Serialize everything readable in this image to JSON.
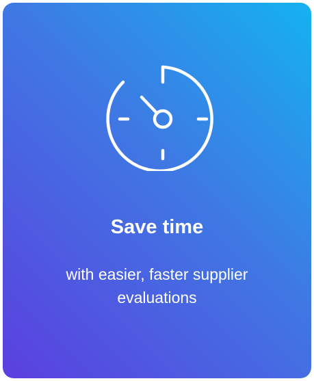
{
  "card": {
    "icon": "stopwatch-timer-icon",
    "title": "Save time",
    "subtitle": "with easier, faster supplier evaluations",
    "gradient_colors": [
      "#14b2f0",
      "#3f78e3",
      "#5b3fdf"
    ],
    "text_color": "#ffffff"
  }
}
